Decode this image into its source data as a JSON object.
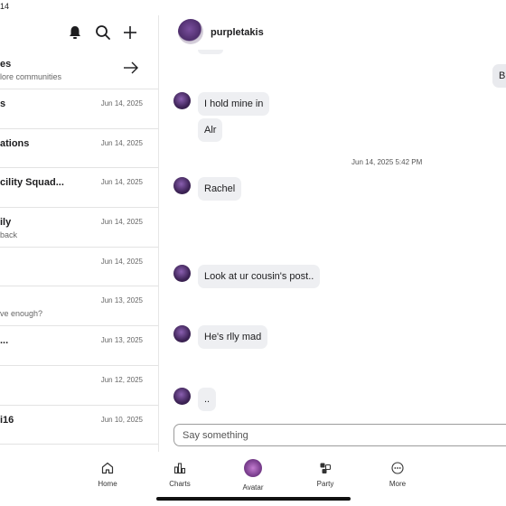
{
  "status_bar": {
    "time": "14"
  },
  "left": {
    "explore": {
      "title": "es",
      "subtitle": "lore communities"
    },
    "chats": [
      {
        "name": "s",
        "preview": "",
        "date": "Jun 14, 2025"
      },
      {
        "name": "ations",
        "preview": "",
        "date": "Jun 14, 2025"
      },
      {
        "name": "cility Squad...",
        "preview": "",
        "date": "Jun 14, 2025"
      },
      {
        "name": "ily",
        "preview": "back",
        "date": "Jun 14, 2025"
      },
      {
        "name": "",
        "preview": "",
        "date": "Jun 14, 2025"
      },
      {
        "name": "",
        "preview": "ve enough?",
        "date": "Jun 13, 2025"
      },
      {
        "name": "...",
        "preview": "",
        "date": "Jun 13, 2025"
      },
      {
        "name": "",
        "preview": "",
        "date": "Jun 12, 2025"
      },
      {
        "name": "i16",
        "preview": "",
        "date": "Jun 10, 2025"
      }
    ]
  },
  "conversation": {
    "header_name": "purpletakis",
    "partial_outgoing": "B",
    "messages": [
      {
        "text": "I hold mine in"
      },
      {
        "text": "Alr"
      },
      {
        "text": "Rachel"
      },
      {
        "text": "Look at ur cousin's post.."
      },
      {
        "text": "He's rlly mad"
      },
      {
        "text": ".."
      }
    ],
    "timestamp": "Jun 14, 2025 5:42 PM",
    "input_placeholder": "Say something"
  },
  "nav": {
    "items": [
      {
        "label": "Home",
        "icon": "home-icon"
      },
      {
        "label": "Charts",
        "icon": "charts-icon"
      },
      {
        "label": "Avatar",
        "icon": "avatar-icon"
      },
      {
        "label": "Party",
        "icon": "party-icon"
      },
      {
        "label": "More",
        "icon": "more-icon"
      }
    ]
  }
}
